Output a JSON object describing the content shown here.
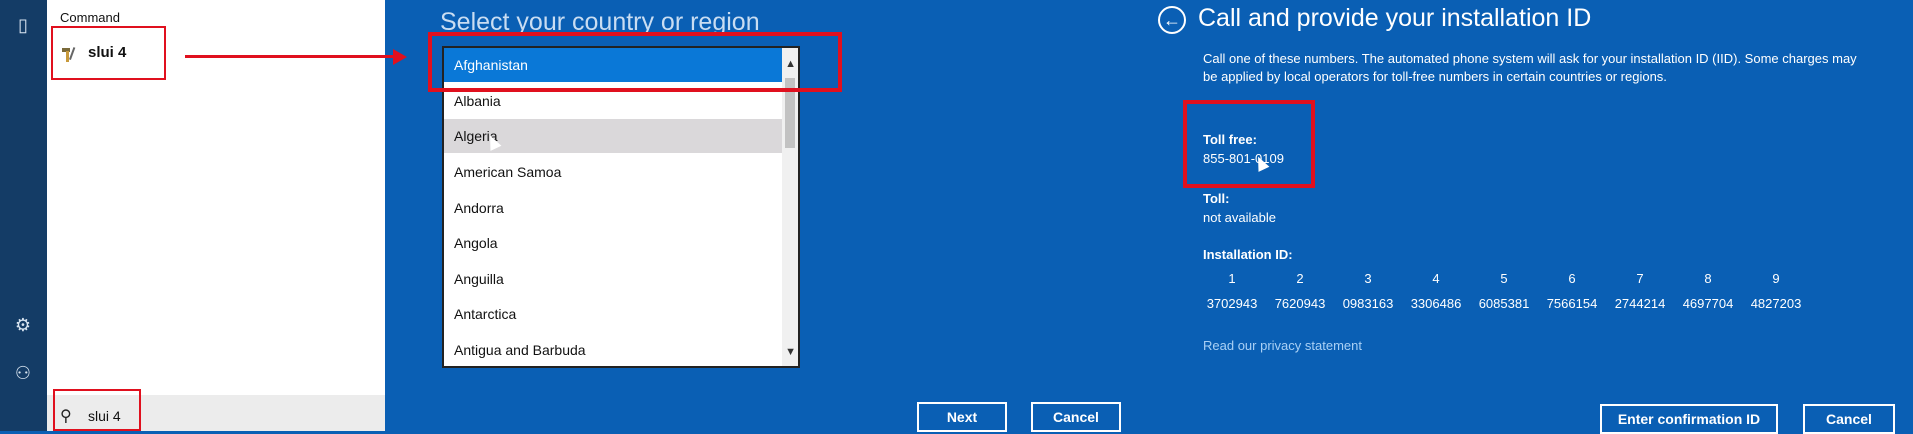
{
  "start_menu": {
    "section_label": "Command",
    "result_label": "slui 4",
    "search_value": "slui 4"
  },
  "country_picker": {
    "title": "Select your country or region",
    "options": [
      "Afghanistan",
      "Albania",
      "Algeria",
      "American Samoa",
      "Andorra",
      "Angola",
      "Anguilla",
      "Antarctica",
      "Antigua and Barbuda"
    ],
    "selected": "Afghanistan",
    "next_label": "Next",
    "cancel_label": "Cancel"
  },
  "installation": {
    "title": "Call and provide your installation ID",
    "description": "Call one of these numbers. The automated phone system will ask for your installation ID (IID). Some charges may be applied by local operators for toll-free numbers in certain countries or regions.",
    "toll_free_label": "Toll free:",
    "toll_free_value": "855-801-0109",
    "toll_label": "Toll:",
    "toll_value": "not available",
    "iid_label": "Installation ID:",
    "iid_columns": [
      "1",
      "2",
      "3",
      "4",
      "5",
      "6",
      "7",
      "8",
      "9"
    ],
    "iid_groups": [
      "3702943",
      "7620943",
      "0983163",
      "3306486",
      "6085381",
      "7566154",
      "2744214",
      "4697704",
      "4827203"
    ],
    "privacy_link": "Read our privacy statement",
    "confirm_label": "Enter confirmation ID",
    "cancel_label": "Cancel"
  },
  "colors": {
    "accent_red": "#e0101e",
    "dialog_blue": "#0a5fb4",
    "selected_blue": "#0a78d7"
  }
}
